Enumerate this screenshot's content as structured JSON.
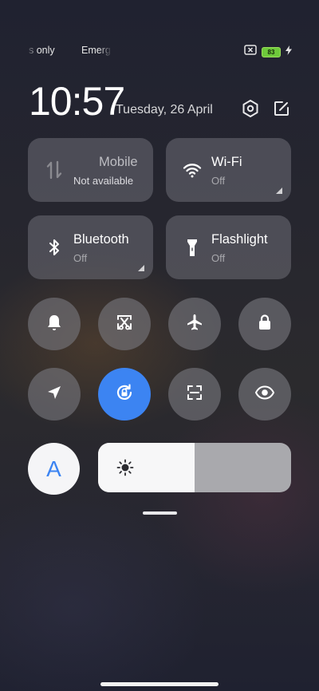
{
  "status_bar": {
    "carrier_left": "s only",
    "carrier_right": "Emerg",
    "battery_level": "83",
    "icons": [
      "sim-x-icon",
      "battery-icon",
      "charging-bolt-icon"
    ]
  },
  "header": {
    "time": "10:57",
    "date": "Tuesday, 26 April",
    "settings_icon": "settings-hexagon-icon",
    "edit_icon": "edit-icon"
  },
  "tiles": [
    {
      "title": "Mobile",
      "subtitle": "Not available",
      "icon": "mobile-data-icon",
      "state": "unavailable"
    },
    {
      "title": "Wi-Fi",
      "subtitle": "Off",
      "icon": "wifi-icon",
      "state": "off"
    },
    {
      "title": "Bluetooth",
      "subtitle": "Off",
      "icon": "bluetooth-icon",
      "state": "off"
    },
    {
      "title": "Flashlight",
      "subtitle": "Off",
      "icon": "flashlight-icon",
      "state": "off"
    }
  ],
  "toggles_row1": [
    "bell-icon",
    "screenshot-scissors-icon",
    "airplane-icon",
    "lock-icon"
  ],
  "toggles_row2": [
    {
      "icon": "location-arrow-icon",
      "active": false
    },
    {
      "icon": "rotation-lock-icon",
      "active": true
    },
    {
      "icon": "scanner-icon",
      "active": false
    },
    {
      "icon": "eye-icon",
      "active": false
    }
  ],
  "brightness": {
    "auto_label": "A",
    "level_percent": 50,
    "icon": "sun-icon",
    "colors": {
      "accent": "#3c84f2",
      "fill": "#f7f7f8",
      "track": "#a9a9ad"
    }
  }
}
